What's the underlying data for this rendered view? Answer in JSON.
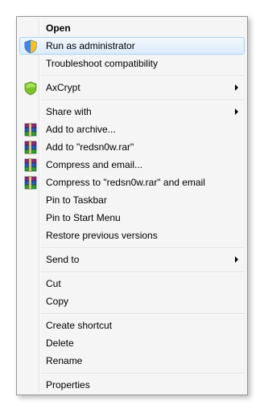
{
  "menu": {
    "items": [
      {
        "label": "Open",
        "icon": "",
        "submenu": false,
        "bold": true
      },
      {
        "label": "Run as administrator",
        "icon": "uac-shield-icon",
        "submenu": false,
        "bold": false,
        "highlighted": true
      },
      {
        "label": "Troubleshoot compatibility",
        "icon": "",
        "submenu": false,
        "bold": false
      },
      {
        "label": "AxCrypt",
        "icon": "axcrypt-shield-icon",
        "submenu": true,
        "bold": false
      },
      {
        "label": "Share with",
        "icon": "",
        "submenu": true,
        "bold": false
      },
      {
        "label": "Add to archive...",
        "icon": "winrar-books-icon",
        "submenu": false,
        "bold": false
      },
      {
        "label": "Add to \"redsn0w.rar\"",
        "icon": "winrar-books-icon",
        "submenu": false,
        "bold": false
      },
      {
        "label": "Compress and email...",
        "icon": "winrar-books-icon",
        "submenu": false,
        "bold": false
      },
      {
        "label": "Compress to \"redsn0w.rar\" and email",
        "icon": "winrar-books-icon",
        "submenu": false,
        "bold": false
      },
      {
        "label": "Pin to Taskbar",
        "icon": "",
        "submenu": false,
        "bold": false
      },
      {
        "label": "Pin to Start Menu",
        "icon": "",
        "submenu": false,
        "bold": false
      },
      {
        "label": "Restore previous versions",
        "icon": "",
        "submenu": false,
        "bold": false
      },
      {
        "label": "Send to",
        "icon": "",
        "submenu": true,
        "bold": false
      },
      {
        "label": "Cut",
        "icon": "",
        "submenu": false,
        "bold": false
      },
      {
        "label": "Copy",
        "icon": "",
        "submenu": false,
        "bold": false
      },
      {
        "label": "Create shortcut",
        "icon": "",
        "submenu": false,
        "bold": false
      },
      {
        "label": "Delete",
        "icon": "",
        "submenu": false,
        "bold": false
      },
      {
        "label": "Rename",
        "icon": "",
        "submenu": false,
        "bold": false
      },
      {
        "label": "Properties",
        "icon": "",
        "submenu": false,
        "bold": false
      }
    ],
    "colors": {
      "highlight_border": "#a8d3f8",
      "highlight_fill": "#dcebfc",
      "menu_background": "#f5f5f5",
      "axcrypt_green": "#7cc22b"
    }
  }
}
